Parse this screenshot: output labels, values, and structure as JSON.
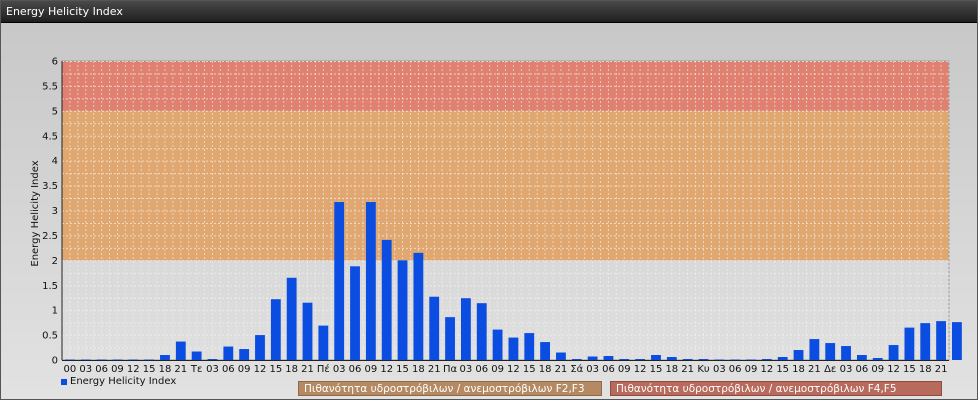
{
  "window": {
    "title": "Energy Helicity Index"
  },
  "chart_data": {
    "type": "bar",
    "title": "",
    "xlabel": "",
    "ylabel": "Energy Helicity Index",
    "ylim": [
      0,
      6
    ],
    "yticks": [
      "0",
      "0.5",
      "1",
      "1.5",
      "2",
      "2.5",
      "3",
      "3.5",
      "4",
      "4.5",
      "5",
      "5.5",
      "6"
    ],
    "grid": true,
    "legend_position": "bottom-left",
    "categories": [
      "00",
      "03",
      "06",
      "09",
      "12",
      "15",
      "18",
      "21",
      "Τε",
      "03",
      "06",
      "09",
      "12",
      "15",
      "18",
      "21",
      "Πέ",
      "03",
      "06",
      "09",
      "12",
      "15",
      "18",
      "21",
      "Πα",
      "03",
      "06",
      "09",
      "12",
      "15",
      "18",
      "21",
      "Σά",
      "03",
      "06",
      "09",
      "12",
      "15",
      "18",
      "21",
      "Κυ",
      "03",
      "06",
      "09",
      "12",
      "15",
      "18",
      "21",
      "Δε",
      "03",
      "06",
      "09",
      "12",
      "15",
      "18",
      "21"
    ],
    "series": [
      {
        "name": "Energy Helicity Index",
        "color": "#0a4de0",
        "values": [
          0.01,
          0.01,
          0.01,
          0.01,
          0.01,
          0.01,
          0.1,
          0.37,
          0.17,
          0.02,
          0.27,
          0.22,
          0.5,
          1.22,
          1.65,
          1.15,
          0.69,
          3.17,
          1.88,
          3.17,
          2.41,
          2.0,
          2.15,
          1.27,
          0.86,
          1.24,
          1.14,
          0.61,
          0.45,
          0.54,
          0.36,
          0.15,
          0.02,
          0.07,
          0.08,
          0.02,
          0.02,
          0.1,
          0.06,
          0.02,
          0.02,
          0.01,
          0.01,
          0.01,
          0.02,
          0.06,
          0.2,
          0.42,
          0.34,
          0.28,
          0.1,
          0.04,
          0.3,
          0.65,
          0.74,
          0.78,
          0.76
        ]
      }
    ],
    "zones": [
      {
        "from": 2,
        "to": 5,
        "color": "#e0a870",
        "label": "Πιθανότητα υδροστρόβιλων / ανεμοστρόβιλων F2,F3"
      },
      {
        "from": 5,
        "to": 6,
        "color": "#e08070",
        "label": "Πιθανότητα υδροστρόβιλων / ανεμοστρόβιλων F4,F5"
      }
    ]
  }
}
